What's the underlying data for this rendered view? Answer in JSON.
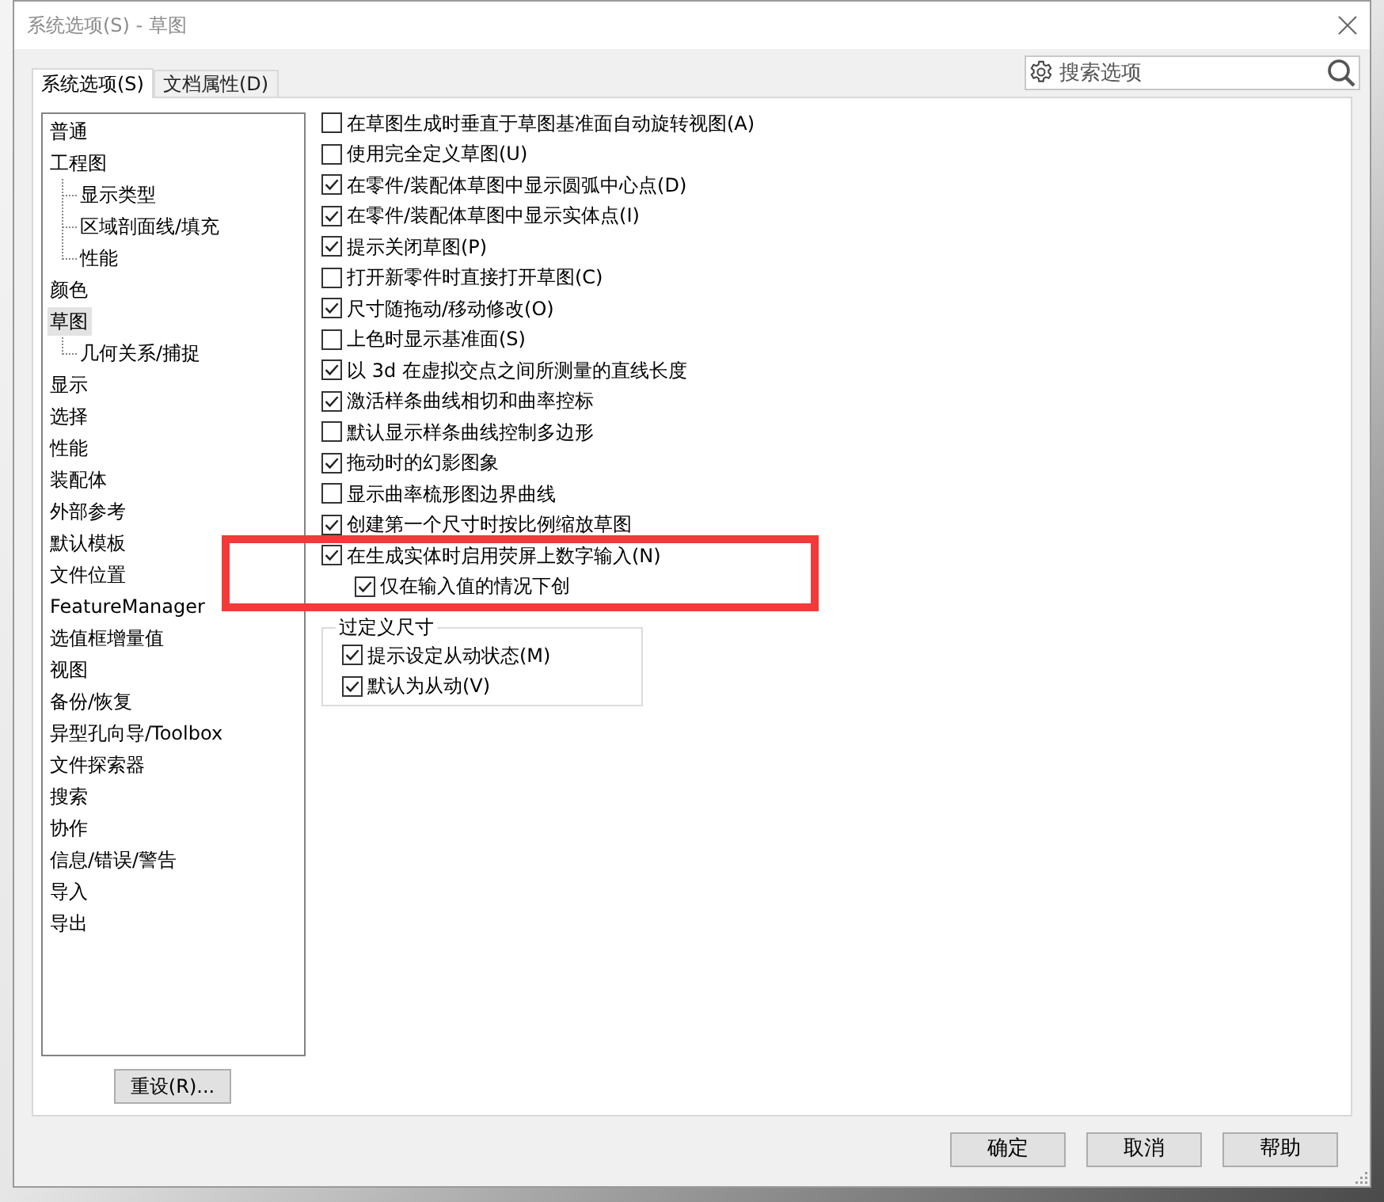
{
  "window": {
    "title": "系统选项(S) - 草图"
  },
  "tabs": [
    {
      "label": "系统选项(S)",
      "selected": true
    },
    {
      "label": "文档属性(D)",
      "selected": false
    }
  ],
  "search": {
    "placeholder": "搜索选项"
  },
  "sidebar": {
    "items": [
      {
        "label": "普通",
        "selected": false
      },
      {
        "label": "工程图",
        "selected": false,
        "children": [
          {
            "label": "显示类型",
            "selected": false
          },
          {
            "label": "区域剖面线/填充",
            "selected": false
          },
          {
            "label": "性能",
            "selected": false
          }
        ]
      },
      {
        "label": "颜色",
        "selected": false
      },
      {
        "label": "草图",
        "selected": true,
        "children": [
          {
            "label": "几何关系/捕捉",
            "selected": false
          }
        ]
      },
      {
        "label": "显示",
        "selected": false
      },
      {
        "label": "选择",
        "selected": false
      },
      {
        "label": "性能",
        "selected": false
      },
      {
        "label": "装配体",
        "selected": false
      },
      {
        "label": "外部参考",
        "selected": false
      },
      {
        "label": "默认模板",
        "selected": false
      },
      {
        "label": "文件位置",
        "selected": false
      },
      {
        "label": "FeatureManager",
        "selected": false
      },
      {
        "label": "选值框增量值",
        "selected": false
      },
      {
        "label": "视图",
        "selected": false
      },
      {
        "label": "备份/恢复",
        "selected": false
      },
      {
        "label": "异型孔向导/Toolbox",
        "selected": false
      },
      {
        "label": "文件探索器",
        "selected": false
      },
      {
        "label": "搜索",
        "selected": false
      },
      {
        "label": "协作",
        "selected": false
      },
      {
        "label": "信息/错误/警告",
        "selected": false
      },
      {
        "label": "导入",
        "selected": false
      },
      {
        "label": "导出",
        "selected": false
      }
    ]
  },
  "reset_button": "重设(R)...",
  "options": [
    {
      "label": "在草图生成时垂直于草图基准面自动旋转视图(A)",
      "checked": false,
      "highlighted": false
    },
    {
      "label": "使用完全定义草图(U)",
      "checked": false,
      "highlighted": false
    },
    {
      "label": "在零件/装配体草图中显示圆弧中心点(D)",
      "checked": true,
      "highlighted": false
    },
    {
      "label": "在零件/装配体草图中显示实体点(I)",
      "checked": true,
      "highlighted": false
    },
    {
      "label": "提示关闭草图(P)",
      "checked": true,
      "highlighted": false
    },
    {
      "label": "打开新零件时直接打开草图(C)",
      "checked": false,
      "highlighted": false
    },
    {
      "label": "尺寸随拖动/移动修改(O)",
      "checked": true,
      "highlighted": false
    },
    {
      "label": "上色时显示基准面(S)",
      "checked": false,
      "highlighted": false
    },
    {
      "label": "以 3d 在虚拟交点之间所测量的直线长度",
      "checked": true,
      "highlighted": false
    },
    {
      "label": "激活样条曲线相切和曲率控标",
      "checked": true,
      "highlighted": false
    },
    {
      "label": "默认显示样条曲线控制多边形",
      "checked": false,
      "highlighted": false
    },
    {
      "label": "拖动时的幻影图象",
      "checked": true,
      "highlighted": false
    },
    {
      "label": "显示曲率梳形图边界曲线",
      "checked": false,
      "highlighted": false
    },
    {
      "label": "创建第一个尺寸时按比例缩放草图",
      "checked": true,
      "highlighted": false
    },
    {
      "label": "在生成实体时启用荧屏上数字输入(N)",
      "checked": true,
      "highlighted": true,
      "children": [
        {
          "label": "仅在输入值的情况下创",
          "checked": true
        }
      ]
    }
  ],
  "overdefined_dimensions": {
    "title": "过定义尺寸",
    "options": [
      {
        "label": "提示设定从动状态(M)",
        "checked": true
      },
      {
        "label": "默认为从动(V)",
        "checked": true
      }
    ]
  },
  "buttons": [
    "确定",
    "取消",
    "帮助"
  ]
}
